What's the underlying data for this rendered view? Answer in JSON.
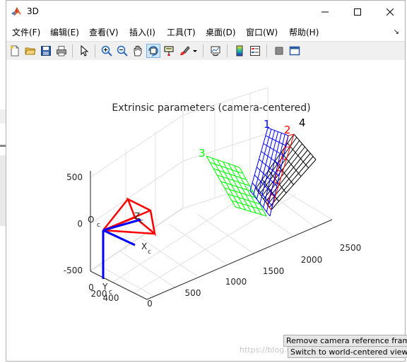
{
  "window": {
    "title": "3D"
  },
  "menu": [
    "文件(F)",
    "编辑(E)",
    "查看(V)",
    "插入(I)",
    "工具(T)",
    "桌面(D)",
    "窗口(W)",
    "帮助(H)"
  ],
  "toolbar": {
    "icons": [
      "new-figure-icon",
      "open-file-icon",
      "save-icon",
      "print-icon",
      "pointer-icon",
      "zoom-in-icon",
      "zoom-out-icon",
      "pan-hand-icon",
      "rotate-3d-icon",
      "data-cursor-icon",
      "brush-icon",
      "link-plot-icon",
      "colorbar-icon",
      "legend-icon",
      "hide-tools-icon",
      "show-tools-icon"
    ],
    "active": "rotate-3d-icon"
  },
  "plot": {
    "title": "Extrinsic parameters (camera-centered)",
    "z_ticks": [
      "500",
      "0",
      "-500"
    ],
    "x_ticks": [
      "0",
      "500",
      "1000",
      "1500",
      "2000",
      "2500"
    ],
    "y_ticks": [
      "0",
      "200",
      "400"
    ],
    "camera_label_o": "O",
    "camera_label_o_sub": "c",
    "axis_x": "X",
    "axis_x_sub": "c",
    "axis_y": "Y",
    "axis_y_sub": "c",
    "axis_z": "Z",
    "axis_z_sub": "c",
    "board_labels": [
      "1",
      "2",
      "3",
      "4"
    ],
    "colors": {
      "board1": "#0000ff",
      "board2": "#ff0000",
      "board3": "#00ff00",
      "board4": "#000000",
      "camera": "#ff0000",
      "axes": "#0000ff"
    }
  },
  "buttons": {
    "remove": "Remove camera reference frame",
    "switch": "Switch to world-centered view"
  },
  "watermark": "https://blog.csdn.net/..."
}
